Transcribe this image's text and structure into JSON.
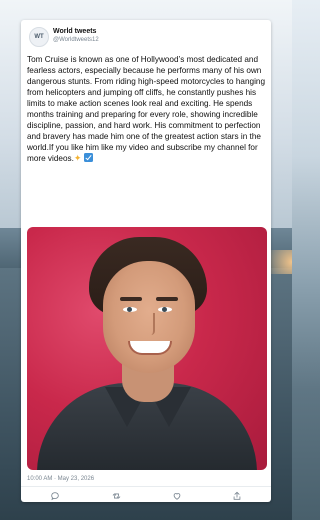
{
  "tweet": {
    "account_name": "World tweets",
    "handle": "@Worldtweets12",
    "avatar_text": "WT",
    "text": "Tom Cruise is known as one of Hollywood’s most dedicated and fearless actors, especially because he performs many of his own dangerous stunts. From riding high-speed motorcycles to hanging from helicopters and jumping off cliffs, he constantly pushes his limits to make action scenes look real and exciting. He spends months training and preparing for every role, showing incredible discipline, passion, and hard work. His commitment to perfection and bravery has made him one of the greatest action stars in the world.If you like him like my video and subscribe my channel for more videos.",
    "timestamp": "10:00 AM · May 23, 2026"
  },
  "icons": {
    "reply": "reply-icon",
    "retweet": "retweet-icon",
    "like": "heart-icon",
    "share": "share-icon"
  },
  "colors": {
    "card": "#ffffff",
    "photo_background": "#c9284b",
    "muted_text": "#7a8691"
  }
}
